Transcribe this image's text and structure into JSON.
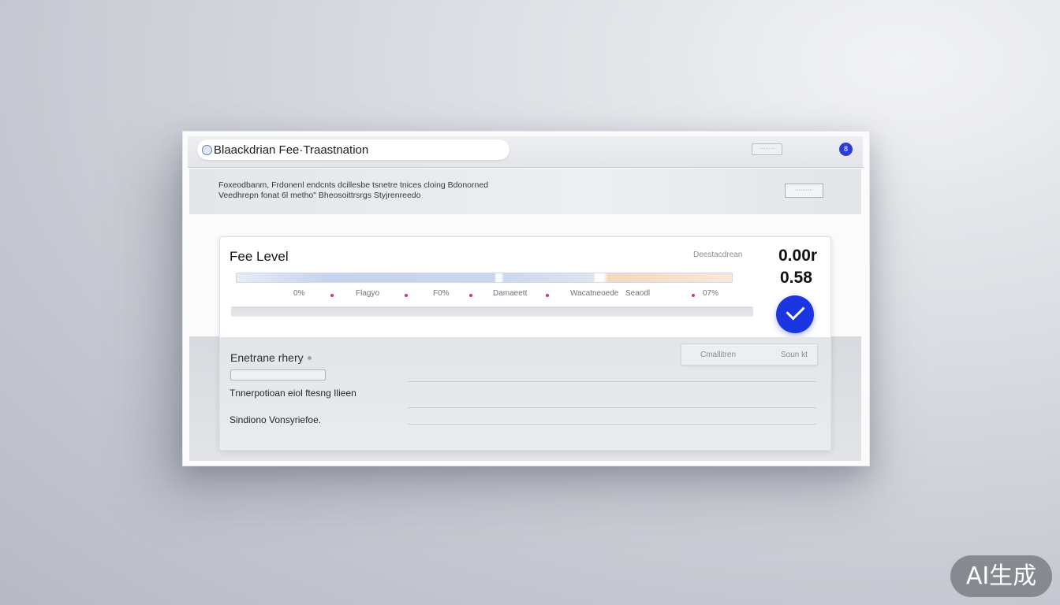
{
  "window": {
    "title": "Blaackdrian Fee·Traastnation",
    "top_button_label": "··········",
    "info_icon_label": "8",
    "description_line1": "Foxeodbanm, Frdonenl endcnts dcillesbe tsnetre tnices cloing Bdonorned",
    "description_line2": "Veedhrepn fonat 6l metho\" Bheosoittrsrgs Styjrenreedo",
    "description_button": "··········"
  },
  "fee_card": {
    "title": "Fee Level",
    "mini_label": "Deestacdrean",
    "value_primary": "0.00r",
    "value_secondary": "0.58",
    "scale_labels": [
      "0%",
      "Flagyo",
      "F0%",
      "Damaeett",
      "Wacatneoede",
      "Seaodl",
      "07%"
    ],
    "confirm_icon": "check-icon"
  },
  "details": {
    "section_title": "Enetrane rhery",
    "tabs": [
      "Cmallitren",
      "Soun kt"
    ],
    "rows": [
      "Tnnerpotioan eiol ftesng Ilieen",
      "Sindiono Vonsyriefoe."
    ]
  },
  "watermark": "AI生成",
  "colors": {
    "accent": "#1b35e0",
    "track_blue": "#c6d3ee",
    "track_orange": "#f6d7b9",
    "marker_red": "#d33a55"
  }
}
